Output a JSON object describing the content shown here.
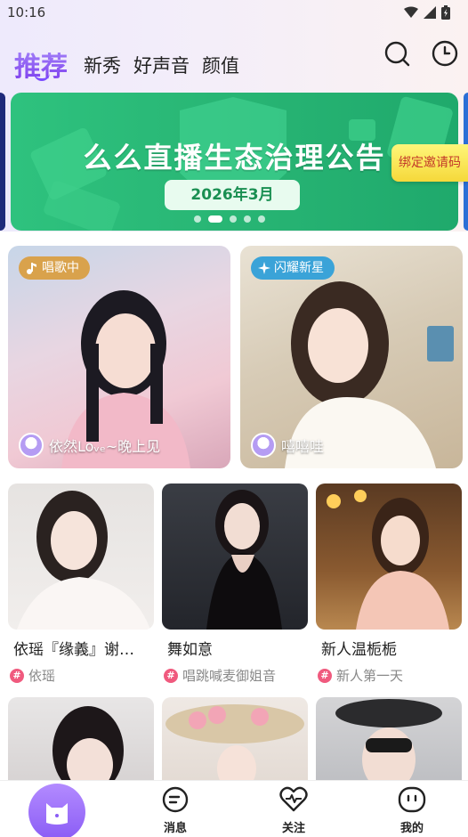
{
  "status": {
    "time": "10:16"
  },
  "tabs": [
    {
      "label": "推荐",
      "active": true
    },
    {
      "label": "新秀"
    },
    {
      "label": "好声音"
    },
    {
      "label": "颜值"
    }
  ],
  "actions": {
    "search_icon": "search-icon",
    "history_icon": "clock-icon"
  },
  "banner": {
    "title": "么么直播生态治理公告",
    "date": "2026年3月",
    "slides": 5,
    "active_slide": 2,
    "color": "#2ec27e"
  },
  "invite": {
    "label": "绑定邀请码"
  },
  "featured": [
    {
      "badge": "唱歌中",
      "badge_color": "#d9a24c",
      "name": "依然Loᵥₑ~晚上见"
    },
    {
      "badge": "闪耀新星",
      "badge_color": "#3aa3d8",
      "name": "嘻嘻哇"
    }
  ],
  "rooms": [
    {
      "title": "依瑶『缘義』谢…",
      "tag": "依瑶"
    },
    {
      "title": "舞如意",
      "tag": "唱跳喊麦御姐音"
    },
    {
      "title": "新人温栀栀",
      "tag": "新人第一天"
    }
  ],
  "nav": {
    "messages": "消息",
    "follow": "关注",
    "mine": "我的"
  }
}
